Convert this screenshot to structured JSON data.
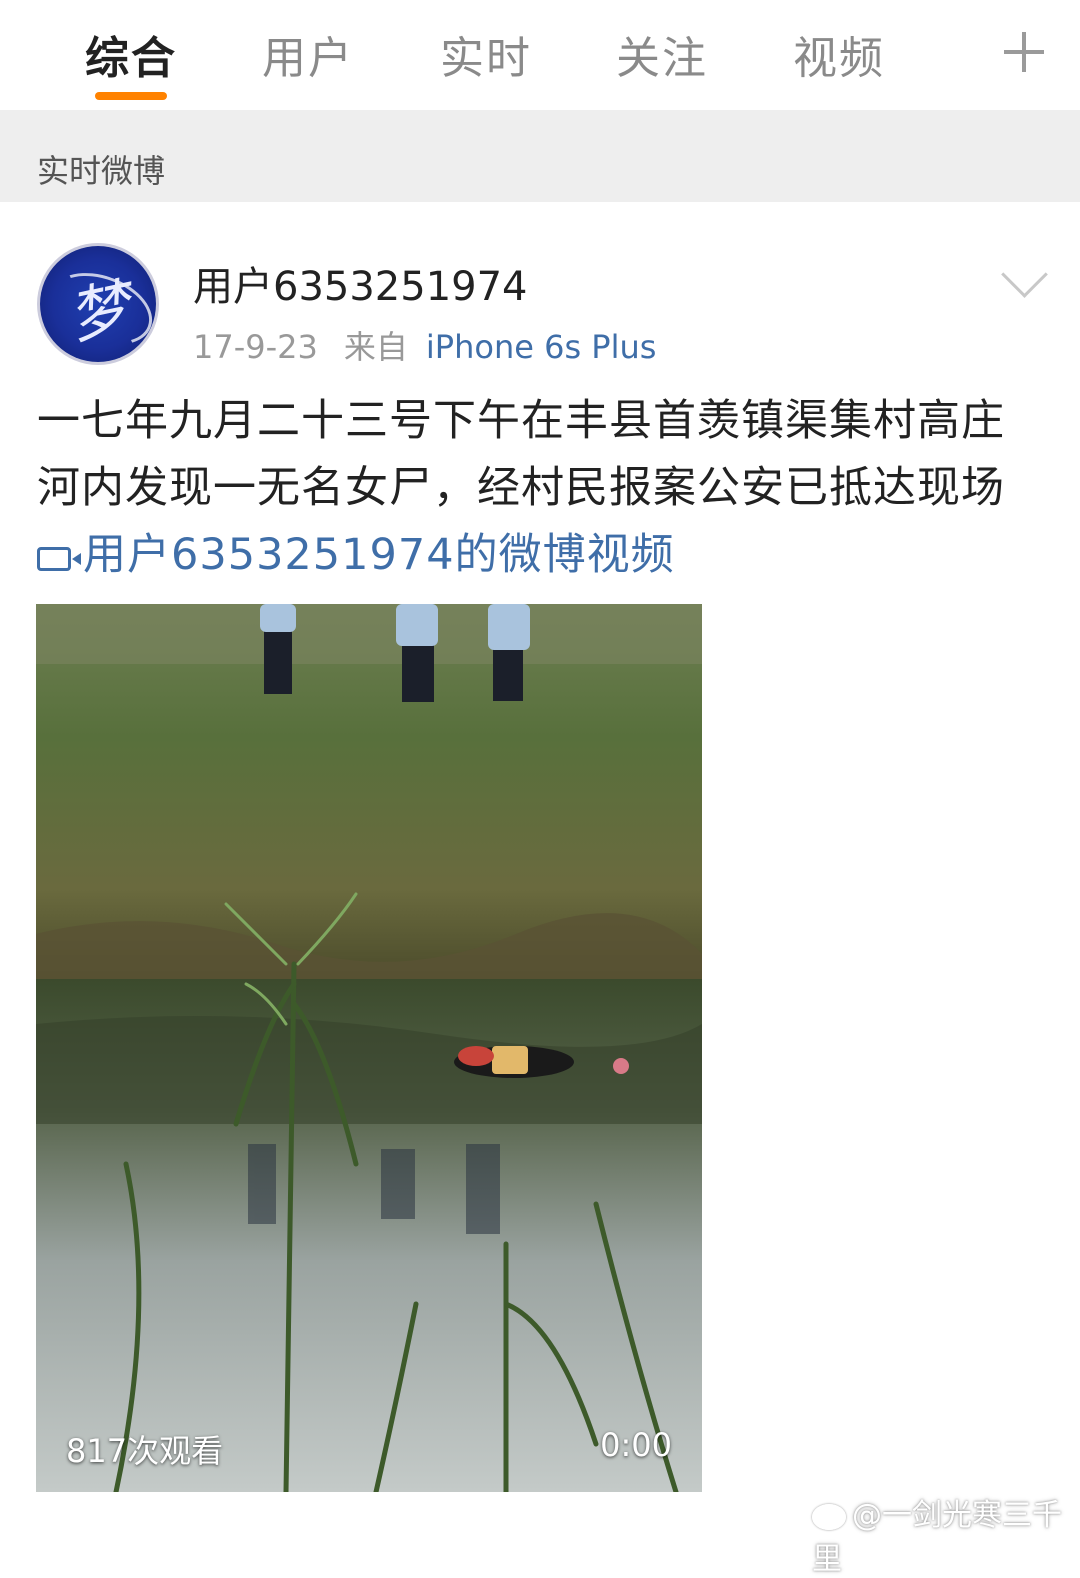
{
  "tabs": [
    {
      "label": "综合",
      "active": true
    },
    {
      "label": "用户",
      "active": false
    },
    {
      "label": "实时",
      "active": false
    },
    {
      "label": "关注",
      "active": false
    },
    {
      "label": "视频",
      "active": false
    }
  ],
  "add_tab_icon": "plus-icon",
  "section": {
    "title": "实时微博"
  },
  "post": {
    "username": "用户6353251974",
    "date": "17-9-23",
    "from_label": "来自",
    "source": "iPhone 6s Plus",
    "text": "一七年九月二十三号下午在丰县首羡镇渠集村高庄河内发现一无名女尸，经村民报案公安已抵达现场",
    "video_link": "用户6353251974的微博视频",
    "video": {
      "views": "817次观看",
      "duration": "0:00"
    }
  },
  "watermark": "@一剑光寒三千里",
  "colors": {
    "accent": "#ff8200",
    "link": "#3f6ea8",
    "section_bg": "#eeeeee"
  }
}
